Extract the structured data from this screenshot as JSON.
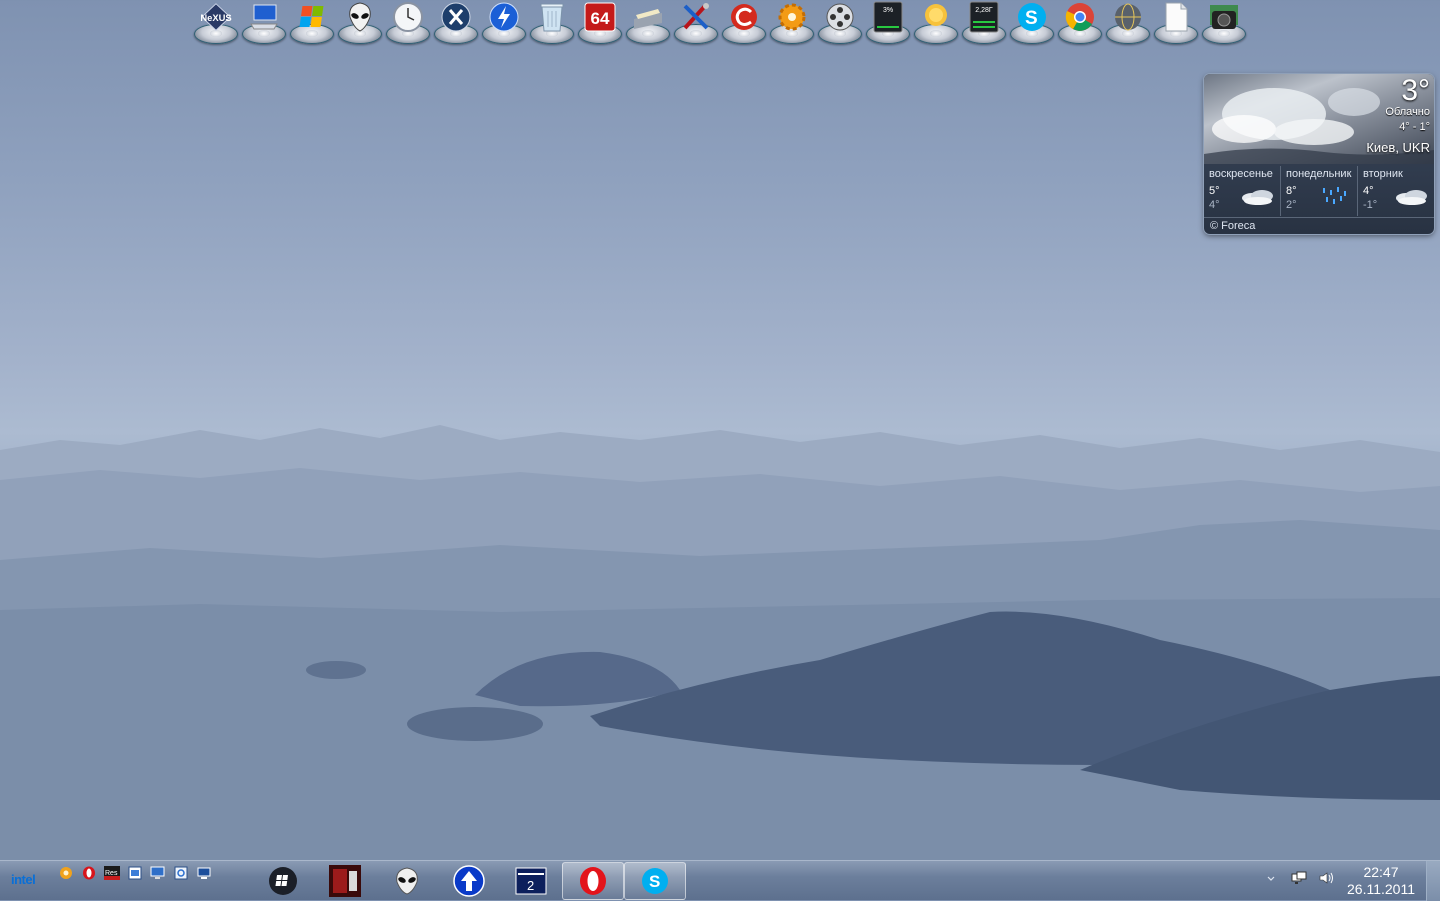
{
  "dock": {
    "items": [
      {
        "name": "nexus-dock-icon",
        "label": "NeXUS"
      },
      {
        "name": "computer-icon",
        "label": ""
      },
      {
        "name": "windows-icon",
        "label": ""
      },
      {
        "name": "alien-icon",
        "label": ""
      },
      {
        "name": "clock-icon",
        "label": ""
      },
      {
        "name": "x-icon",
        "label": ""
      },
      {
        "name": "lightning-icon",
        "label": ""
      },
      {
        "name": "recycle-bin-icon",
        "label": ""
      },
      {
        "name": "aida64-icon",
        "label": "64"
      },
      {
        "name": "scanner-icon",
        "label": ""
      },
      {
        "name": "tools-icon",
        "label": ""
      },
      {
        "name": "ccleaner-icon",
        "label": ""
      },
      {
        "name": "settings-gear-icon",
        "label": ""
      },
      {
        "name": "film-reel-icon",
        "label": ""
      },
      {
        "name": "cpu-meter-icon",
        "label": "3%"
      },
      {
        "name": "weather-sun-icon",
        "label": ""
      },
      {
        "name": "memory-meter-icon",
        "label": "2,28Г"
      },
      {
        "name": "skype-icon",
        "label": ""
      },
      {
        "name": "chrome-icon",
        "label": ""
      },
      {
        "name": "globe-icon",
        "label": ""
      },
      {
        "name": "document-icon",
        "label": ""
      },
      {
        "name": "camera-icon",
        "label": ""
      }
    ]
  },
  "weather": {
    "temperature": "3°",
    "condition": "Облачно",
    "range": "4° - 1°",
    "city": "Киев, UKR",
    "days": [
      {
        "name": "воскресенье",
        "high": "5°",
        "low": "4°",
        "icon": "cloud-icon"
      },
      {
        "name": "понедельник",
        "high": "8°",
        "low": "2°",
        "icon": "rain-icon"
      },
      {
        "name": "вторник",
        "high": "4°",
        "low": "-1°",
        "icon": "cloud-icon"
      }
    ],
    "credit": "© Foreca"
  },
  "taskbar": {
    "intel_label": "intel",
    "quick_launch": [
      "gear-icon",
      "opera-icon",
      "res-icon",
      "window-icon",
      "monitor-icon",
      "network-icon",
      "desktop-icon"
    ],
    "pinned": [
      {
        "name": "start-orb-button",
        "active": false
      },
      {
        "name": "game-app-button",
        "active": false
      },
      {
        "name": "alien-app-button",
        "active": false
      },
      {
        "name": "upload-app-button",
        "active": false
      },
      {
        "name": "network-app-button",
        "active": false
      },
      {
        "name": "opera-app-button",
        "active": true
      },
      {
        "name": "skype-app-button",
        "active": true
      }
    ],
    "clock_time": "22:47",
    "clock_date": "26.11.2011"
  },
  "colors": {
    "accent": "#0a6fd6",
    "skype": "#00aff0",
    "opera": "#e3141b"
  }
}
